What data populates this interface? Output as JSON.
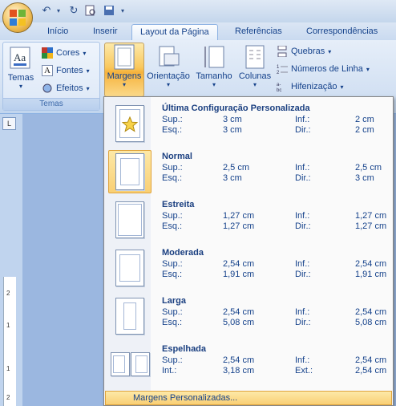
{
  "quick_access": {
    "office_button_icon": "office-logo-icon",
    "undo_icon": "undo-icon",
    "redo_icon": "redo-icon",
    "print_preview_icon": "print-preview-icon",
    "save_icon": "save-icon",
    "dropdown_icon": "chevron-down-icon"
  },
  "tabs": [
    {
      "label": "Início"
    },
    {
      "label": "Inserir"
    },
    {
      "label": "Layout da Página"
    },
    {
      "label": "Referências"
    },
    {
      "label": "Correspondências"
    }
  ],
  "ribbon": {
    "temas_group": {
      "label": "Temas",
      "temas_button": "Temas",
      "cores": "Cores",
      "fontes": "Fontes",
      "efeitos": "Efeitos"
    },
    "page_setup": {
      "margens": "Margens",
      "orientacao": "Orientação",
      "tamanho": "Tamanho",
      "colunas": "Colunas",
      "quebras": "Quebras",
      "numeros_linha": "Números de Linha",
      "hifenizacao": "Hifenização"
    }
  },
  "margins_menu": {
    "items": [
      {
        "name": "Última Configuração Personalizada",
        "l1": "Sup.:",
        "v1": "3 cm",
        "l2": "Inf.:",
        "v2": "2 cm",
        "l3": "Esq.:",
        "v3": "3 cm",
        "l4": "Dir.:",
        "v4": "2 cm"
      },
      {
        "name": "Normal",
        "l1": "Sup.:",
        "v1": "2,5 cm",
        "l2": "Inf.:",
        "v2": "2,5 cm",
        "l3": "Esq.:",
        "v3": "3 cm",
        "l4": "Dir.:",
        "v4": "3 cm"
      },
      {
        "name": "Estreita",
        "l1": "Sup.:",
        "v1": "1,27 cm",
        "l2": "Inf.:",
        "v2": "1,27 cm",
        "l3": "Esq.:",
        "v3": "1,27 cm",
        "l4": "Dir.:",
        "v4": "1,27 cm"
      },
      {
        "name": "Moderada",
        "l1": "Sup.:",
        "v1": "2,54 cm",
        "l2": "Inf.:",
        "v2": "2,54 cm",
        "l3": "Esq.:",
        "v3": "1,91 cm",
        "l4": "Dir.:",
        "v4": "1,91 cm"
      },
      {
        "name": "Larga",
        "l1": "Sup.:",
        "v1": "2,54 cm",
        "l2": "Inf.:",
        "v2": "2,54 cm",
        "l3": "Esq.:",
        "v3": "5,08 cm",
        "l4": "Dir.:",
        "v4": "5,08 cm"
      },
      {
        "name": "Espelhada",
        "l1": "Sup.:",
        "v1": "2,54 cm",
        "l2": "Inf.:",
        "v2": "2,54 cm",
        "l3": "Int.:",
        "v3": "3,18 cm",
        "l4": "Ext.:",
        "v4": "2,54 cm"
      }
    ],
    "custom_label": "Margens Personalizadas..."
  },
  "ruler": {
    "tab_selector": "L",
    "marks": [
      "2",
      "1",
      "1",
      "2"
    ]
  },
  "colors": {
    "accent_highlight": "#f9c85e",
    "text_blue": "#15428b"
  }
}
